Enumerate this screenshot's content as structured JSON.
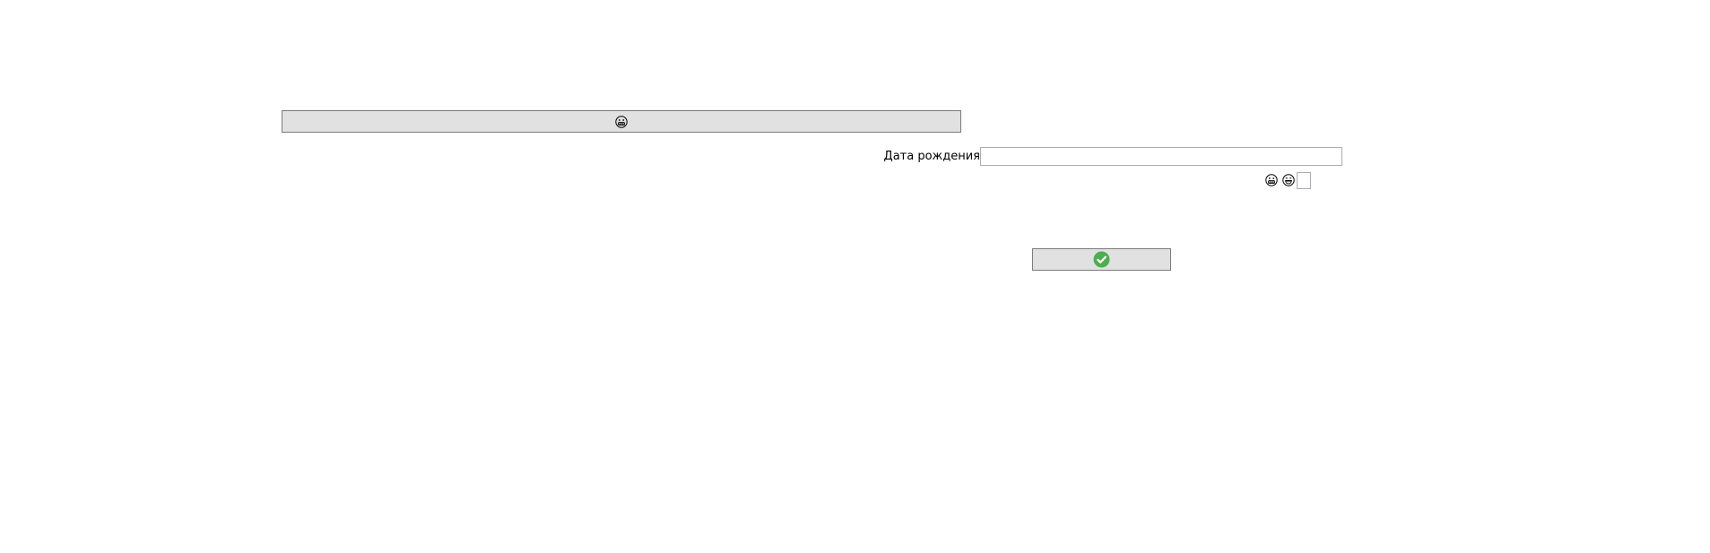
{
  "top_button": {
    "icon": "grimacing-face-icon"
  },
  "dob": {
    "label": "Дата рождения",
    "value": "",
    "placeholder": ""
  },
  "emoji_row": {
    "icons": [
      "grimacing-face-icon",
      "grinning-face-icon"
    ],
    "checkbox_checked": false
  },
  "confirm_button": {
    "icon": "check-circle-icon",
    "icon_color": "#4caf50"
  },
  "colors": {
    "button_bg": "#e1e1e1",
    "button_border": "#7a7a7a",
    "input_border": "#abadb3"
  }
}
